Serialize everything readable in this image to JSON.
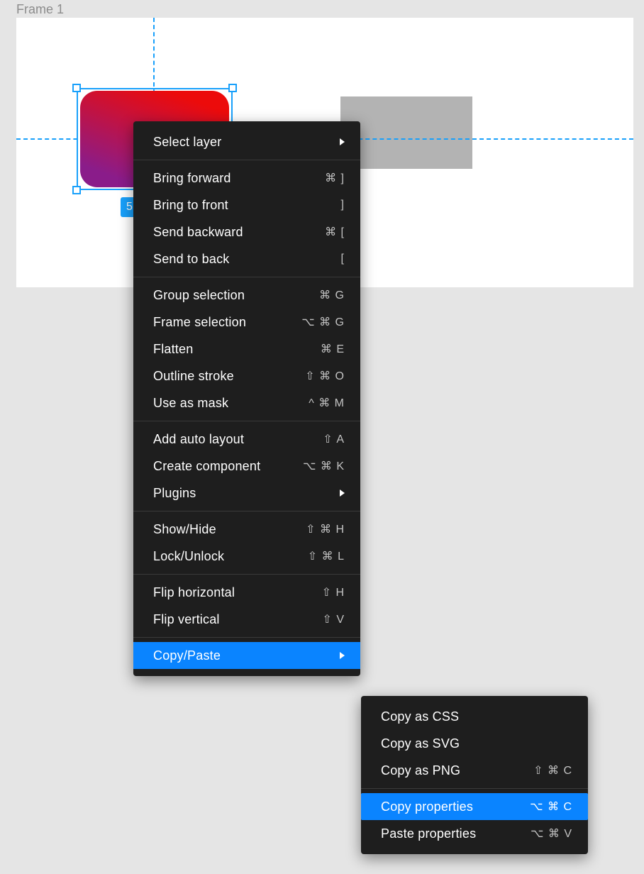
{
  "frame": {
    "label": "Frame 1"
  },
  "badge": {
    "text": "5"
  },
  "menu_main": {
    "select_layer": "Select layer",
    "bring_forward": "Bring forward",
    "bring_forward_sc": "⌘ ]",
    "bring_to_front": "Bring to front",
    "bring_to_front_sc": "]",
    "send_backward": "Send backward",
    "send_backward_sc": "⌘ [",
    "send_to_back": "Send to back",
    "send_to_back_sc": "[",
    "group_selection": "Group selection",
    "group_selection_sc": "⌘ G",
    "frame_selection": "Frame selection",
    "frame_selection_sc": "⌥ ⌘ G",
    "flatten": "Flatten",
    "flatten_sc": "⌘ E",
    "outline_stroke": "Outline stroke",
    "outline_stroke_sc": "⇧ ⌘ O",
    "use_as_mask": "Use as mask",
    "use_as_mask_sc": "^ ⌘ M",
    "add_auto_layout": "Add auto layout",
    "add_auto_layout_sc": "⇧ A",
    "create_component": "Create component",
    "create_component_sc": "⌥ ⌘ K",
    "plugins": "Plugins",
    "show_hide": "Show/Hide",
    "show_hide_sc": "⇧ ⌘ H",
    "lock_unlock": "Lock/Unlock",
    "lock_unlock_sc": "⇧ ⌘ L",
    "flip_h": "Flip horizontal",
    "flip_h_sc": "⇧ H",
    "flip_v": "Flip vertical",
    "flip_v_sc": "⇧ V",
    "copy_paste": "Copy/Paste"
  },
  "menu_sub": {
    "copy_css": "Copy as CSS",
    "copy_svg": "Copy as SVG",
    "copy_png": "Copy as PNG",
    "copy_png_sc": "⇧ ⌘ C",
    "copy_props": "Copy properties",
    "copy_props_sc": "⌥ ⌘ C",
    "paste_props": "Paste properties",
    "paste_props_sc": "⌥ ⌘ V"
  }
}
